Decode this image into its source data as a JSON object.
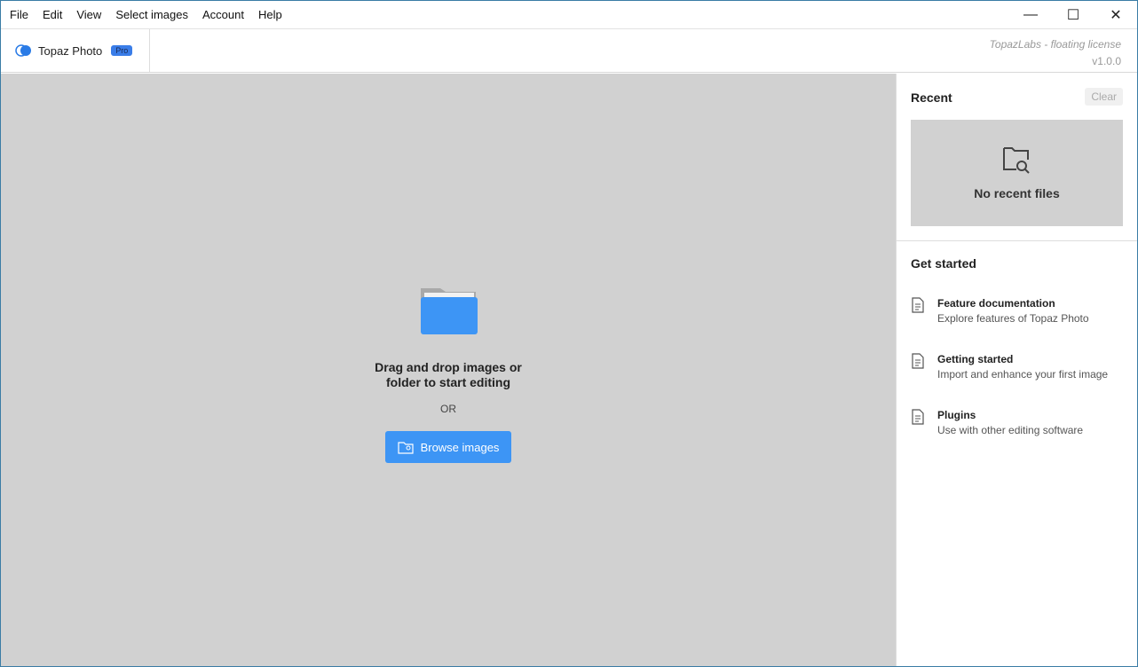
{
  "menu": [
    "File",
    "Edit",
    "View",
    "Select images",
    "Account",
    "Help"
  ],
  "window": {
    "minimize": "—",
    "maximize": "☐",
    "close": "✕"
  },
  "brand": {
    "name": "Topaz Photo",
    "badge": "Pro"
  },
  "license": {
    "text": "TopazLabs - floating license",
    "version": "v1.0.0"
  },
  "main": {
    "drop_text": "Drag and drop images or folder to start editing",
    "or": "OR",
    "browse": "Browse images"
  },
  "sidebar": {
    "recent_title": "Recent",
    "clear": "Clear",
    "empty": "No recent files",
    "get_started": "Get started",
    "items": [
      {
        "title": "Feature documentation",
        "desc": "Explore features of Topaz Photo"
      },
      {
        "title": "Getting started",
        "desc": "Import and enhance your first image"
      },
      {
        "title": "Plugins",
        "desc": "Use with other editing software"
      }
    ]
  },
  "colors": {
    "accent": "#3d95f5",
    "canvas": "#d1d1d1"
  }
}
